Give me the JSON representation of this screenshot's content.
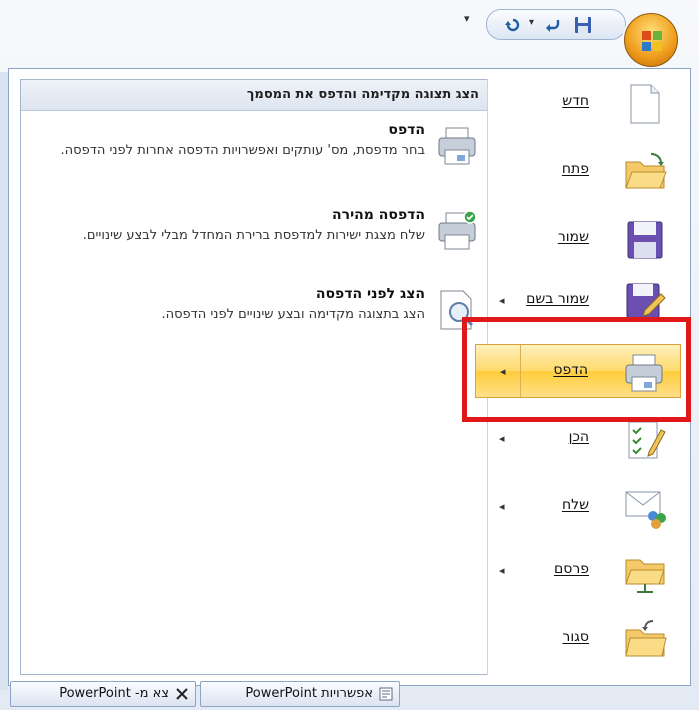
{
  "qat": {
    "undo_arrow": "▾",
    "customize_arrow": "▾"
  },
  "submenu": {
    "title": "הצג תצוגה מקדימה והדפס את המסמך",
    "options": [
      {
        "title": "הדפס",
        "desc": "בחר מדפסת, מס' עותקים ואפשרויות הדפסה אחרות לפני הדפסה.",
        "icon": "printer-icon"
      },
      {
        "title": "הדפסה מהירה",
        "desc": "שלח מצגת ישירות למדפסת ברירת המחדל מבלי לבצע שינויים.",
        "icon": "quick-print-icon"
      },
      {
        "title": "הצג לפני הדפסה",
        "desc": "הצג בתצוגה מקדימה ובצע שינויים לפני הדפסה.",
        "icon": "print-preview-icon"
      }
    ]
  },
  "menu": {
    "items": [
      {
        "label": "חדש",
        "icon": "new-document-icon",
        "arrow": ""
      },
      {
        "label": "פתח",
        "icon": "open-folder-icon",
        "arrow": ""
      },
      {
        "label": "שמור",
        "icon": "save-disk-icon",
        "arrow": ""
      },
      {
        "label": "שמור בשם",
        "icon": "save-as-icon",
        "arrow": "◂"
      },
      {
        "label": "הדפס",
        "icon": "printer-icon",
        "arrow": "◂"
      },
      {
        "label": "הכן",
        "icon": "prepare-icon",
        "arrow": "◂"
      },
      {
        "label": "שלח",
        "icon": "send-icon",
        "arrow": "◂"
      },
      {
        "label": "פרסם",
        "icon": "publish-icon",
        "arrow": "◂"
      },
      {
        "label": "סגור",
        "icon": "close-folder-icon",
        "arrow": ""
      }
    ]
  },
  "footer": {
    "options_label": "אפשרויות PowerPoint",
    "exit_label": "צא מ- PowerPoint"
  },
  "colors": {
    "highlight": "#ffd96a",
    "annotation": "#e01818"
  }
}
